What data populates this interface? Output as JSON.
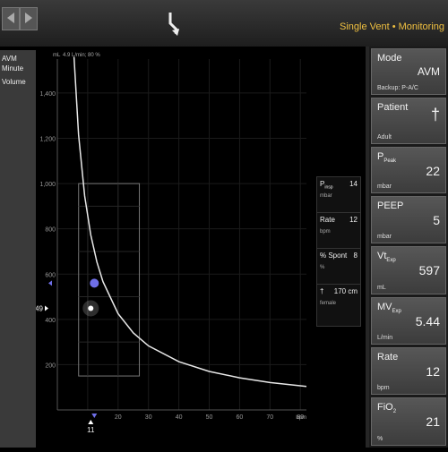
{
  "header": {
    "breadcrumb": "Single Vent • Monitoring"
  },
  "left_label": {
    "line1": "AVM Minute",
    "line2": "Volume"
  },
  "chart": {
    "readout": "4.9 L/min; 80 %",
    "y_unit": "mL",
    "x_unit": "bpm",
    "y_ticks": [
      "1,400",
      "1,200",
      "1,000",
      "800",
      "600",
      "400",
      "200"
    ],
    "x_ticks": [
      "10",
      "20",
      "30",
      "40",
      "50",
      "60",
      "70",
      "80"
    ],
    "current_y_label": "449",
    "current_x_label": "11"
  },
  "chart_data": {
    "type": "line",
    "xlabel": "bpm",
    "ylabel": "mL",
    "xlim": [
      0,
      82
    ],
    "ylim": [
      0,
      1550
    ],
    "series": [
      {
        "x": [
          5.5,
          7,
          9,
          11,
          13,
          15,
          20,
          25,
          30,
          40,
          50,
          60,
          70,
          82
        ],
        "values": [
          1560,
          1215,
          945,
          773,
          654,
          567,
          425,
          340,
          283,
          213,
          170,
          142,
          121,
          104
        ]
      }
    ],
    "current_point": {
      "x": 11,
      "y": 449
    },
    "target_marker": {
      "x": 11,
      "y": 560
    },
    "target_window": {
      "x": [
        7,
        27
      ],
      "y": [
        150,
        1000
      ]
    }
  },
  "side_legend": [
    {
      "label": "P",
      "sub": "insp",
      "value": "14",
      "unit": "mbar"
    },
    {
      "label": "Rate",
      "sub": "",
      "value": "12",
      "unit": "bpm"
    },
    {
      "label": "% Spont",
      "sub": "",
      "value": "8",
      "unit": "%"
    },
    {
      "label": "†",
      "sub": "",
      "value": "170 cm",
      "unit": "female"
    }
  ],
  "right_panel": [
    {
      "label": "Mode",
      "sub": "",
      "value": "AVM",
      "unit": "Backup: P-A/C"
    },
    {
      "label": "Patient",
      "sub": "",
      "value": "†",
      "unit": "Adult"
    },
    {
      "label": "P",
      "sub": "Peak",
      "value": "22",
      "unit": "mbar"
    },
    {
      "label": "PEEP",
      "sub": "",
      "value": "5",
      "unit": "mbar"
    },
    {
      "label": "Vt",
      "sub": "Exp",
      "value": "597",
      "unit": "mL"
    },
    {
      "label": "MV",
      "sub": "Exp",
      "value": "5.44",
      "unit": "L/min"
    },
    {
      "label": "Rate",
      "sub": "",
      "value": "12",
      "unit": "bpm"
    },
    {
      "label": "FiO",
      "sub": "2",
      "value": "21",
      "unit": "%"
    }
  ],
  "colors": {
    "accent": "#f0c040",
    "curve": "#e8e8e8",
    "marker": "#6f6fe8"
  }
}
